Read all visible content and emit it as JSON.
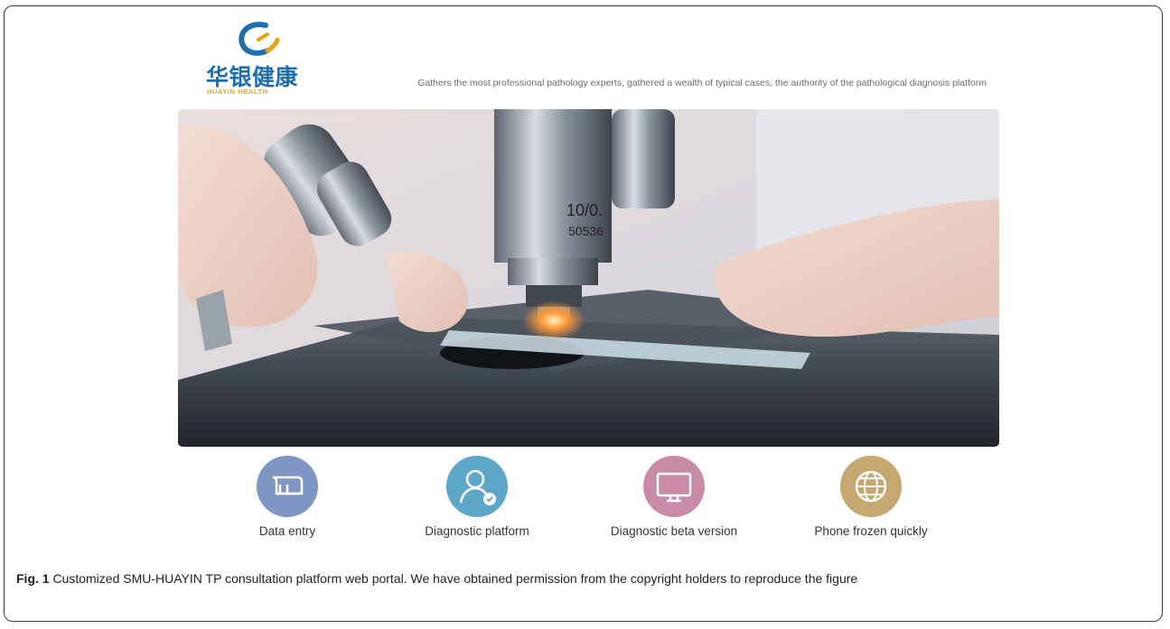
{
  "brand": {
    "name_cn": "华银健康",
    "name_en": "HUAYIN HEALTH",
    "tagline": "Gathers the most professional pathology experts, gathered a wealth of typical cases, the authority of the pathological diagnosis platform",
    "colors": {
      "blue": "#1f6fb0",
      "gold": "#e2a31b"
    }
  },
  "hero": {
    "image": "microscope-photo"
  },
  "features": [
    {
      "label": "Data entry",
      "icon": "document-scroll-icon",
      "color": "#7f95c4"
    },
    {
      "label": "Diagnostic platform",
      "icon": "doctor-user-icon",
      "color": "#5ea7c9"
    },
    {
      "label": "Diagnostic beta version",
      "icon": "monitor-icon",
      "color": "#c98aa8"
    },
    {
      "label": "Phone frozen quickly",
      "icon": "globe-icon",
      "color": "#c5a86f"
    }
  ],
  "caption": {
    "label": "Fig. 1",
    "text": " Customized SMU-HUAYIN TP consultation platform web portal. We have obtained permission from the copyright holders to reproduce the figure"
  }
}
